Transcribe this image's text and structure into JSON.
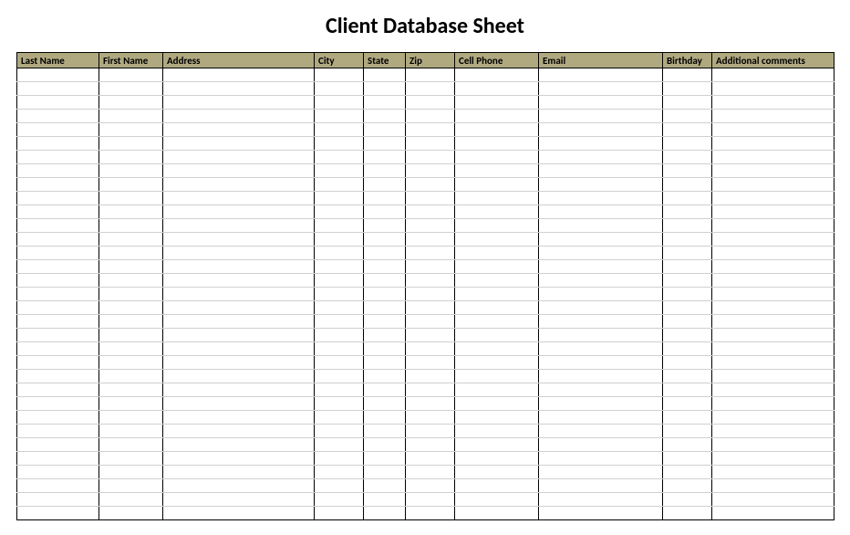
{
  "title": "Client Database Sheet",
  "table": {
    "columns": [
      {
        "key": "last_name",
        "label": "Last Name",
        "widthClass": "col-last-name"
      },
      {
        "key": "first_name",
        "label": "First Name",
        "widthClass": "col-first-name"
      },
      {
        "key": "address",
        "label": "Address",
        "widthClass": "col-address"
      },
      {
        "key": "city",
        "label": "City",
        "widthClass": "col-city"
      },
      {
        "key": "state",
        "label": "State",
        "widthClass": "col-state"
      },
      {
        "key": "zip",
        "label": "Zip",
        "widthClass": "col-zip"
      },
      {
        "key": "cell_phone",
        "label": "Cell Phone",
        "widthClass": "col-cell-phone"
      },
      {
        "key": "email",
        "label": "Email",
        "widthClass": "col-email"
      },
      {
        "key": "birthday",
        "label": "Birthday",
        "widthClass": "col-birthday"
      },
      {
        "key": "comments",
        "label": "Additional comments",
        "widthClass": "col-comments"
      }
    ],
    "rowCount": 33,
    "rows": []
  }
}
